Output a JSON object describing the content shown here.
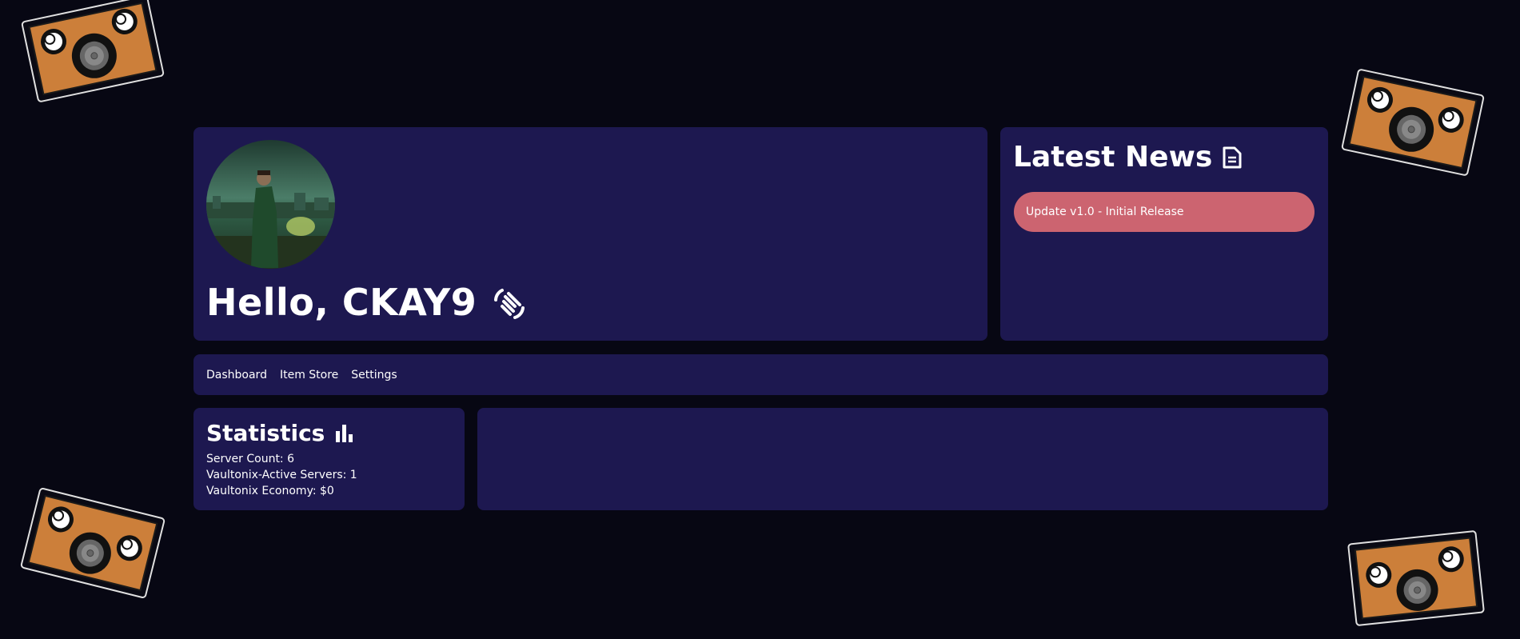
{
  "hero": {
    "greeting": "Hello, CKAY9",
    "wave_icon": "waving-hand-icon",
    "avatar_icon": "user-avatar"
  },
  "news": {
    "title": "Latest News",
    "title_icon": "document-icon",
    "items": [
      {
        "label": "Update v1.0 - Initial Release"
      }
    ]
  },
  "nav": {
    "items": [
      {
        "label": "Dashboard"
      },
      {
        "label": "Item Store"
      },
      {
        "label": "Settings"
      }
    ]
  },
  "stats": {
    "title": "Statistics",
    "title_icon": "bar-chart-icon",
    "lines": [
      "Server Count: 6",
      "Vaultonix-Active Servers: 1",
      "Vaultonix Economy: $0"
    ]
  },
  "colors": {
    "background": "#070713",
    "card": "#1d1850",
    "news_item": "#cc6470",
    "speaker_orange": "#cc7f3a",
    "text": "#ffffff"
  },
  "decorations": {
    "icon": "speaker-box-icon"
  }
}
